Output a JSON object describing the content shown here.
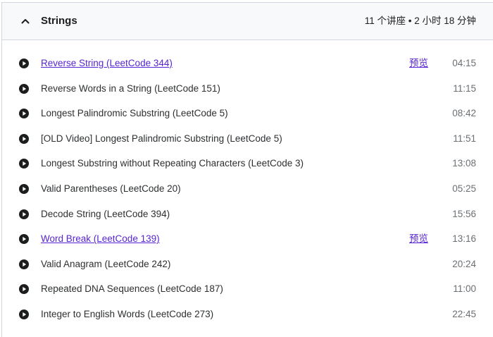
{
  "section": {
    "title": "Strings",
    "meta": "11 个讲座 • 2 小时 18 分钟",
    "expanded": true,
    "icon": "chevron-up-icon"
  },
  "lecture_icon": "play-circle-icon",
  "colors": {
    "link": "#5624d0",
    "text": "#2d2f31",
    "duration": "#6a6f73",
    "header_bg": "#f7f9fa"
  },
  "lectures": [
    {
      "title": "Reverse String (LeetCode 344)",
      "preview": "预览",
      "duration": "04:15",
      "is_link": true
    },
    {
      "title": "Reverse Words in a String (LeetCode 151)",
      "duration": "11:15",
      "is_link": false
    },
    {
      "title": "Longest Palindromic Substring (LeetCode 5)",
      "duration": "08:42",
      "is_link": false
    },
    {
      "title": "[OLD Video] Longest Palindromic Substring (LeetCode 5)",
      "duration": "11:51",
      "is_link": false
    },
    {
      "title": "Longest Substring without Repeating Characters (LeetCode 3)",
      "duration": "13:08",
      "is_link": false
    },
    {
      "title": "Valid Parentheses (LeetCode 20)",
      "duration": "05:25",
      "is_link": false
    },
    {
      "title": "Decode String (LeetCode 394)",
      "duration": "15:56",
      "is_link": false
    },
    {
      "title": "Word Break (LeetCode 139)",
      "preview": "预览",
      "duration": "13:16",
      "is_link": true
    },
    {
      "title": "Valid Anagram (LeetCode 242)",
      "duration": "20:24",
      "is_link": false
    },
    {
      "title": "Repeated DNA Sequences (LeetCode 187)",
      "duration": "11:00",
      "is_link": false
    },
    {
      "title": "Integer to English Words (LeetCode 273)",
      "duration": "22:45",
      "is_link": false
    }
  ]
}
